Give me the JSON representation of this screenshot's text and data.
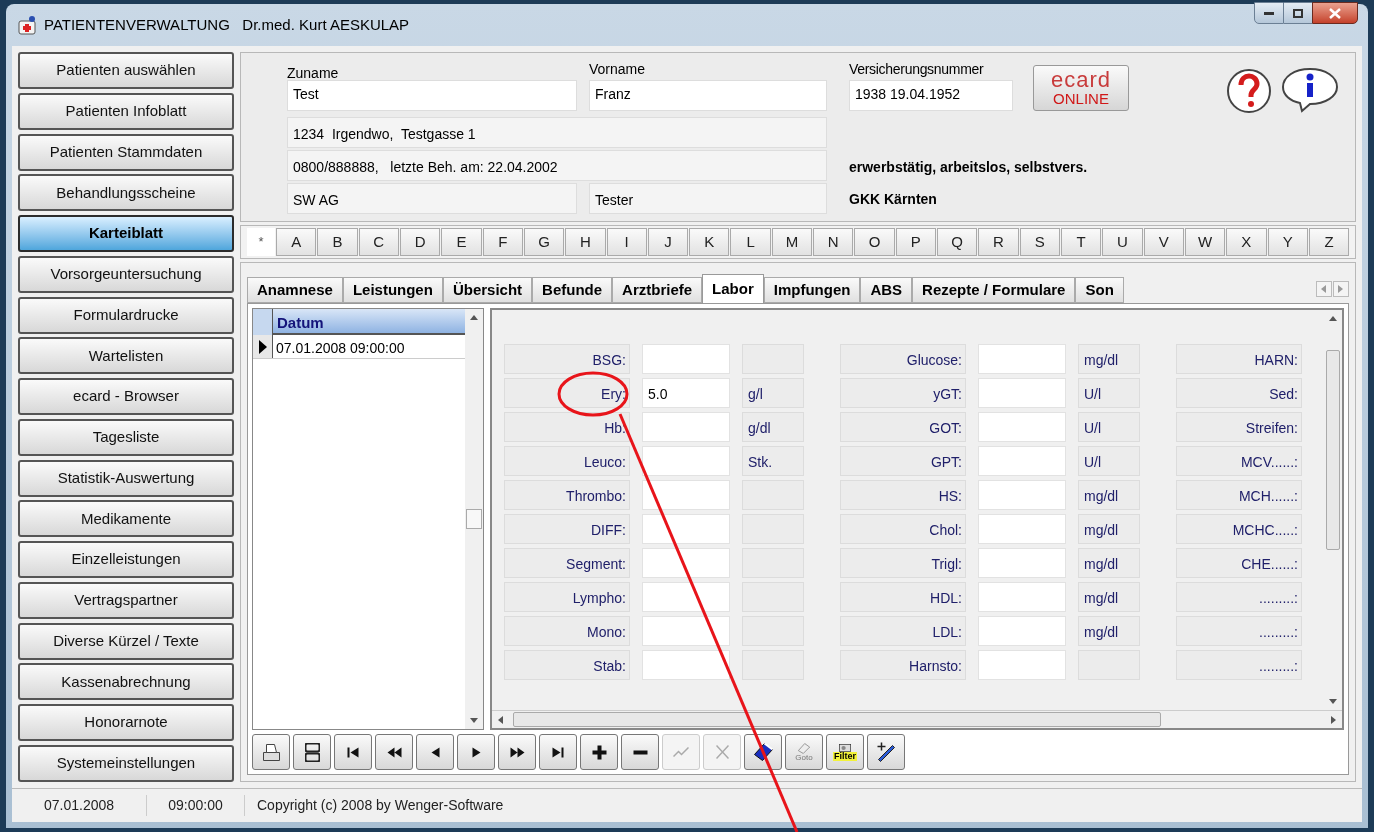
{
  "window": {
    "title": "PATIENTENVERWALTUNG   Dr.med. Kurt AESKULAP"
  },
  "sidebar": {
    "items": [
      {
        "label": "Patienten auswählen",
        "selected": false
      },
      {
        "label": "Patienten Infoblatt",
        "selected": false
      },
      {
        "label": "Patienten Stammdaten",
        "selected": false
      },
      {
        "label": "Behandlungsscheine",
        "selected": false
      },
      {
        "label": "Karteiblatt",
        "selected": true
      },
      {
        "label": "Vorsorgeuntersuchung",
        "selected": false
      },
      {
        "label": "Formulardrucke",
        "selected": false
      },
      {
        "label": "Wartelisten",
        "selected": false
      },
      {
        "label": "ecard - Browser",
        "selected": false
      },
      {
        "label": "Tagesliste",
        "selected": false
      },
      {
        "label": "Statistik-Auswertung",
        "selected": false
      },
      {
        "label": "Medikamente",
        "selected": false
      },
      {
        "label": "Einzelleistungen",
        "selected": false
      },
      {
        "label": "Vertragspartner",
        "selected": false
      },
      {
        "label": "Diverse Kürzel / Texte",
        "selected": false
      },
      {
        "label": "Kassenabrechnung",
        "selected": false
      },
      {
        "label": "Honorarnote",
        "selected": false
      },
      {
        "label": "Systemeinstellungen",
        "selected": false
      }
    ]
  },
  "patient": {
    "surname_label": "Zuname",
    "surname": "Test",
    "first_name_label": "Vorname",
    "first_name": "Franz",
    "insurance_label": "Versicherungsnummer",
    "insurance_number": "1938  19.04.1952",
    "ecard_top": "ecard",
    "ecard_bottom": "ONLINE",
    "address": "1234  Irgendwo,  Testgasse 1",
    "contact": "0800/888888,   letzte Beh. am: 22.04.2002",
    "employer": "SW AG",
    "occupation": "Tester",
    "status": "erwerbstätig, arbeitslos, selbstvers.",
    "insurer": "GKK Kärnten"
  },
  "alphabet": [
    {
      "label": "*",
      "kind": "all"
    },
    {
      "label": "A",
      "kind": "letter"
    },
    {
      "label": "B",
      "kind": "letter"
    },
    {
      "label": "C",
      "kind": "letter"
    },
    {
      "label": "D",
      "kind": "letter"
    },
    {
      "label": "E",
      "kind": "letter"
    },
    {
      "label": "F",
      "kind": "letter"
    },
    {
      "label": "G",
      "kind": "letter"
    },
    {
      "label": "H",
      "kind": "letter"
    },
    {
      "label": "I",
      "kind": "letter"
    },
    {
      "label": "J",
      "kind": "letter"
    },
    {
      "label": "K",
      "kind": "letter"
    },
    {
      "label": "L",
      "kind": "letter"
    },
    {
      "label": "M",
      "kind": "letter"
    },
    {
      "label": "N",
      "kind": "letter"
    },
    {
      "label": "O",
      "kind": "letter"
    },
    {
      "label": "P",
      "kind": "letter"
    },
    {
      "label": "Q",
      "kind": "letter"
    },
    {
      "label": "R",
      "kind": "letter"
    },
    {
      "label": "S",
      "kind": "letter"
    },
    {
      "label": "T",
      "kind": "letter"
    },
    {
      "label": "U",
      "kind": "letter"
    },
    {
      "label": "V",
      "kind": "letter"
    },
    {
      "label": "W",
      "kind": "letter"
    },
    {
      "label": "X",
      "kind": "letter"
    },
    {
      "label": "Y",
      "kind": "letter"
    },
    {
      "label": "Z",
      "kind": "letter"
    }
  ],
  "tabs": [
    {
      "label": "Anamnese",
      "selected": false
    },
    {
      "label": "Leistungen",
      "selected": false
    },
    {
      "label": "Übersicht",
      "selected": false
    },
    {
      "label": "Befunde",
      "selected": false
    },
    {
      "label": "Arztbriefe",
      "selected": false
    },
    {
      "label": "Labor",
      "selected": true
    },
    {
      "label": "Impfungen",
      "selected": false
    },
    {
      "label": "ABS",
      "selected": false
    },
    {
      "label": "Rezepte / Formulare",
      "selected": false
    },
    {
      "label": "Son",
      "selected": false
    }
  ],
  "date_list": {
    "column": "Datum",
    "rows": [
      {
        "text": "07.01.2008 09:00:00",
        "selected": true
      }
    ]
  },
  "lab": {
    "groups": [
      {
        "kind": "full",
        "rows": [
          {
            "label": "BSG:",
            "value": "",
            "unit": ""
          },
          {
            "label": "Ery:",
            "value": "5.0",
            "unit": "g/l"
          },
          {
            "label": "Hb:",
            "value": "",
            "unit": "g/dl"
          },
          {
            "label": "Leuco:",
            "value": "",
            "unit": "Stk."
          },
          {
            "label": "Thrombo:",
            "value": "",
            "unit": ""
          },
          {
            "label": "DIFF:",
            "value": "",
            "unit": ""
          },
          {
            "label": "Segment:",
            "value": "",
            "unit": ""
          },
          {
            "label": "Lympho:",
            "value": "",
            "unit": ""
          },
          {
            "label": "Mono:",
            "value": "",
            "unit": ""
          },
          {
            "label": "Stab:",
            "value": "",
            "unit": ""
          }
        ]
      },
      {
        "kind": "full",
        "rows": [
          {
            "label": "Glucose:",
            "value": "",
            "unit": "mg/dl"
          },
          {
            "label": "yGT:",
            "value": "",
            "unit": "U/l"
          },
          {
            "label": "GOT:",
            "value": "",
            "unit": "U/l"
          },
          {
            "label": "GPT:",
            "value": "",
            "unit": "U/l"
          },
          {
            "label": "HS:",
            "value": "",
            "unit": "mg/dl"
          },
          {
            "label": "Chol:",
            "value": "",
            "unit": "mg/dl"
          },
          {
            "label": "Trigl:",
            "value": "",
            "unit": "mg/dl"
          },
          {
            "label": "HDL:",
            "value": "",
            "unit": "mg/dl"
          },
          {
            "label": "LDL:",
            "value": "",
            "unit": "mg/dl"
          },
          {
            "label": "Harnsto:",
            "value": "",
            "unit": ""
          }
        ]
      },
      {
        "kind": "label_only",
        "rows": [
          {
            "label": "HARN:"
          },
          {
            "label": "Sed:"
          },
          {
            "label": "Streifen:"
          },
          {
            "label": "MCV......:"
          },
          {
            "label": "MCH......:"
          },
          {
            "label": "MCHC.....:"
          },
          {
            "label": "CHE......:"
          },
          {
            "label": ".........:"
          },
          {
            "label": ".........:"
          },
          {
            "label": ".........:"
          }
        ]
      }
    ]
  },
  "toolbar": [
    {
      "kind": "print",
      "disabled": false
    },
    {
      "kind": "layout",
      "disabled": false
    },
    {
      "kind": "first",
      "disabled": false
    },
    {
      "kind": "prev_page",
      "disabled": false
    },
    {
      "kind": "prev",
      "disabled": false
    },
    {
      "kind": "next",
      "disabled": false
    },
    {
      "kind": "next_page",
      "disabled": false
    },
    {
      "kind": "last",
      "disabled": false
    },
    {
      "kind": "add",
      "disabled": false
    },
    {
      "kind": "remove",
      "disabled": false
    },
    {
      "kind": "edit",
      "disabled": true
    },
    {
      "kind": "cancel",
      "disabled": true
    },
    {
      "kind": "save",
      "disabled": false
    },
    {
      "kind": "goto",
      "disabled": false,
      "label": "Goto"
    },
    {
      "kind": "filter",
      "disabled": false,
      "label": "Filter"
    },
    {
      "kind": "pen",
      "disabled": false
    }
  ],
  "status_bar": {
    "date": "07.01.2008",
    "time": "09:00:00",
    "text": "Copyright (c) 2008 by Wenger-Software"
  }
}
